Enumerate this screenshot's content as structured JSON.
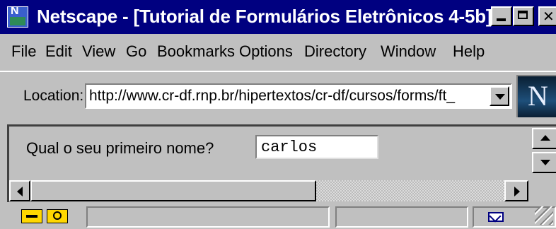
{
  "window": {
    "title": "Netscape - [Tutorial de Formulários Eletrônicos 4-5b]"
  },
  "menu": {
    "items": [
      "File",
      "Edit",
      "View",
      "Go",
      "Bookmarks",
      "Options",
      "Directory",
      "Window",
      "Help"
    ]
  },
  "location": {
    "label": "Location:",
    "url": "http://www.cr-df.rnp.br/hipertextos/cr-df/cursos/forms/ft_"
  },
  "logo": {
    "letter": "N"
  },
  "form": {
    "question": "Qual o seu primeiro nome?",
    "name_value": "carlos"
  },
  "colors": {
    "titlebar": "#000080",
    "chrome": "#c0c0c0"
  },
  "icons": {
    "status": [
      "security-key-icon",
      "connection-icon",
      "mail-icon"
    ]
  }
}
